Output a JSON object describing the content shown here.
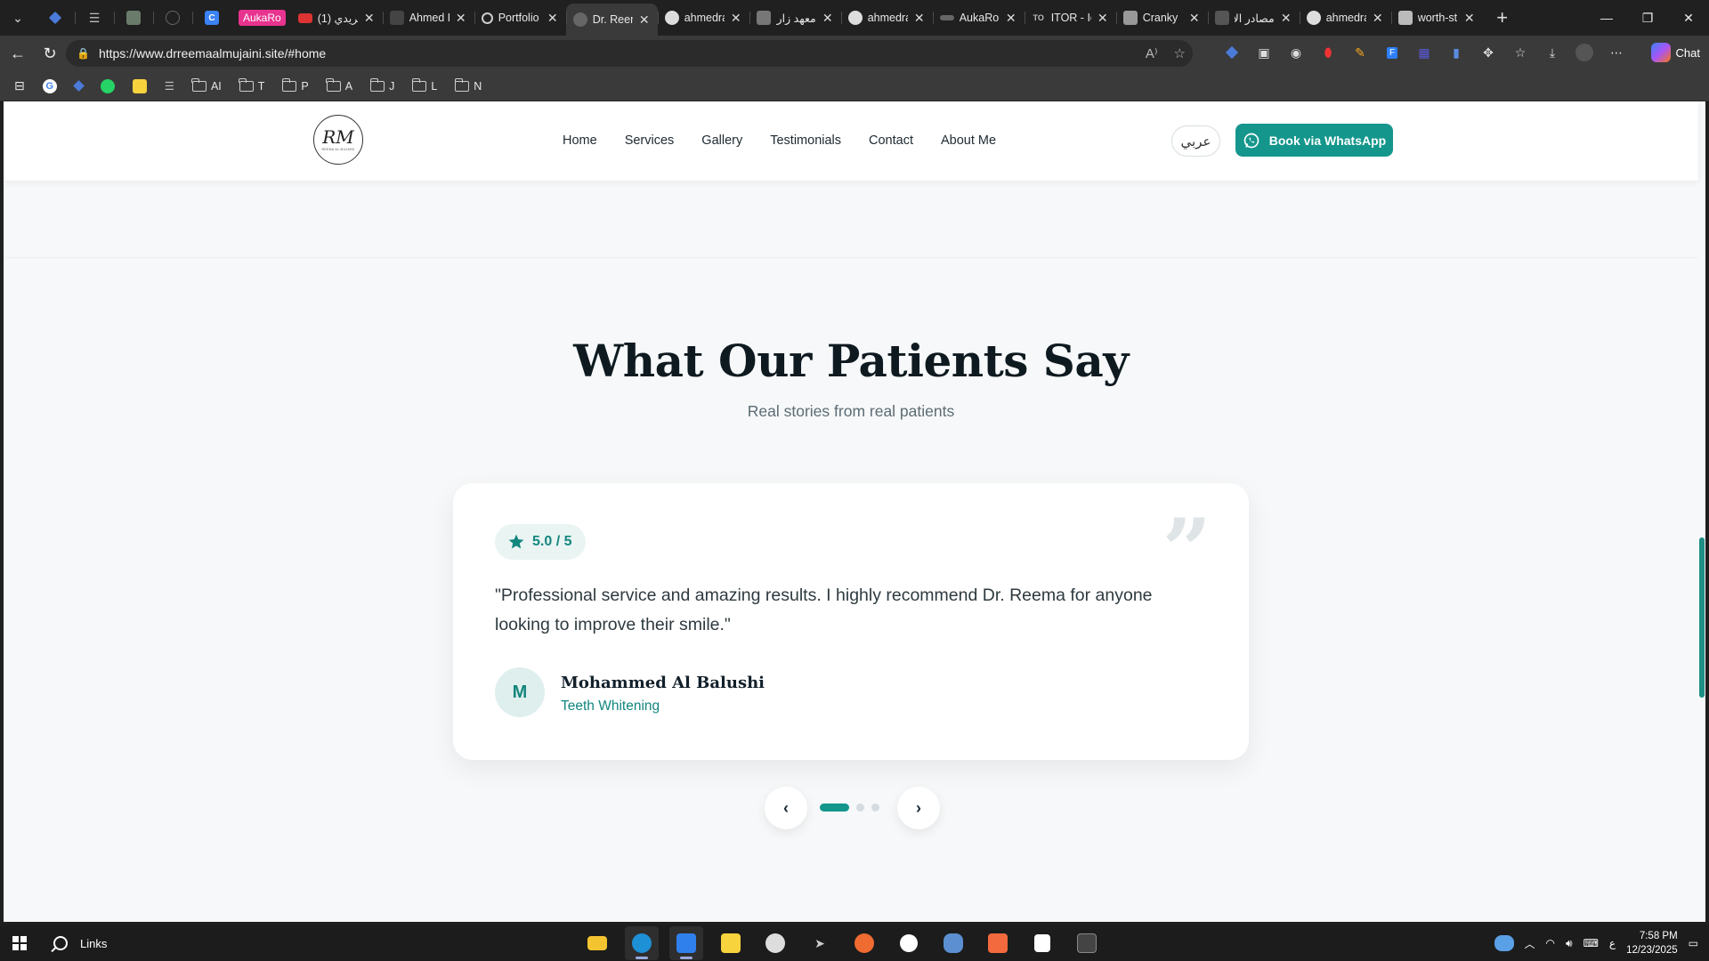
{
  "browser": {
    "pinned_tabs": [
      {
        "icon": "gem-icon",
        "color": "#4b7bd8"
      },
      {
        "icon": "list-icon",
        "color": "#bbbbbb"
      },
      {
        "icon": "app-icon",
        "color": "#6b7b6b"
      },
      {
        "icon": "whatsapp-icon",
        "color": "#555555"
      },
      {
        "icon": "c-letter-icon",
        "label": "C",
        "color": "#3b82f6"
      }
    ],
    "badge_label": "AukaRo",
    "tabs": [
      {
        "title": "(1) فريدي",
        "icon": "youtube-icon",
        "color": "#d33"
      },
      {
        "title": "Ahmed R",
        "icon": "site-icon",
        "color": "#444"
      },
      {
        "title": "Portfolio",
        "icon": "portfolio-icon",
        "color": "#888"
      },
      {
        "title": "Dr. Reem",
        "icon": "site-icon",
        "color": "#888",
        "active": true
      },
      {
        "title": "ahmedra",
        "icon": "github-icon",
        "color": "#ddd"
      },
      {
        "title": "معهد زارا",
        "icon": "page-icon",
        "color": "#777"
      },
      {
        "title": "ahmedra",
        "icon": "github-icon",
        "color": "#ddd"
      },
      {
        "title": "AukaRo",
        "icon": "site-icon",
        "color": "#666"
      },
      {
        "title": "ITOR - Ic",
        "icon": "to-icon",
        "label": "TO",
        "color": "#555"
      },
      {
        "title": "Cranky",
        "icon": "page-icon",
        "color": "#999"
      },
      {
        "title": "مصادر الا",
        "icon": "site-icon",
        "color": "#666"
      },
      {
        "title": "ahmedra",
        "icon": "github-icon",
        "color": "#ddd"
      },
      {
        "title": "worth-st",
        "icon": "page-icon",
        "color": "#bbb"
      }
    ],
    "url": "https://www.drreemaalmujaini.site/#home",
    "chat_label": "Chat",
    "bookmarks": [
      "AI",
      "T",
      "P",
      "A",
      "J",
      "L",
      "N"
    ]
  },
  "site": {
    "logo_monogram": "RM",
    "logo_subtitle": "REEMA AL MUJAINI",
    "nav": [
      "Home",
      "Services",
      "Gallery",
      "Testimonials",
      "Contact",
      "About Me"
    ],
    "lang_button": "عربي",
    "whatsapp_button": "Book via WhatsApp"
  },
  "testimonials": {
    "heading": "What Our Patients Say",
    "subheading": "Real stories from real patients",
    "rating": "5.0 / 5",
    "quote": "\"Professional service and amazing results. I highly recommend Dr. Reema for anyone looking to improve their smile.\"",
    "avatar_initial": "M",
    "author": "Mohammed Al Balushi",
    "treatment": "Teeth Whitening",
    "dots": 3,
    "active_dot": 0,
    "accent_color": "#14968c"
  },
  "taskbar": {
    "search_label": "Links",
    "apps": [
      {
        "icon": "file-explorer-icon",
        "color": "#f4c430"
      },
      {
        "icon": "edge-icon",
        "color": "#1e90d6",
        "active": true
      },
      {
        "icon": "vscode-icon",
        "color": "#2f80ed",
        "active": true
      },
      {
        "icon": "sticky-notes-icon",
        "color": "#f7d33d"
      },
      {
        "icon": "clock-app-icon",
        "color": "#dddddd"
      },
      {
        "icon": "terminal-arrow-icon",
        "color": "#cccccc"
      },
      {
        "icon": "postman-icon",
        "color": "#ef6b31"
      },
      {
        "icon": "dark-app-icon",
        "color": "#ffffff"
      },
      {
        "icon": "postgres-icon",
        "color": "#5b8fd1"
      },
      {
        "icon": "xampp-icon",
        "color": "#f26a3d"
      },
      {
        "icon": "bag-app-icon",
        "color": "#ffffff"
      },
      {
        "icon": "terminal-icon",
        "color": "#888888"
      }
    ],
    "tray_lang": "ع",
    "time": "7:58 PM",
    "date": "12/23/2025"
  }
}
